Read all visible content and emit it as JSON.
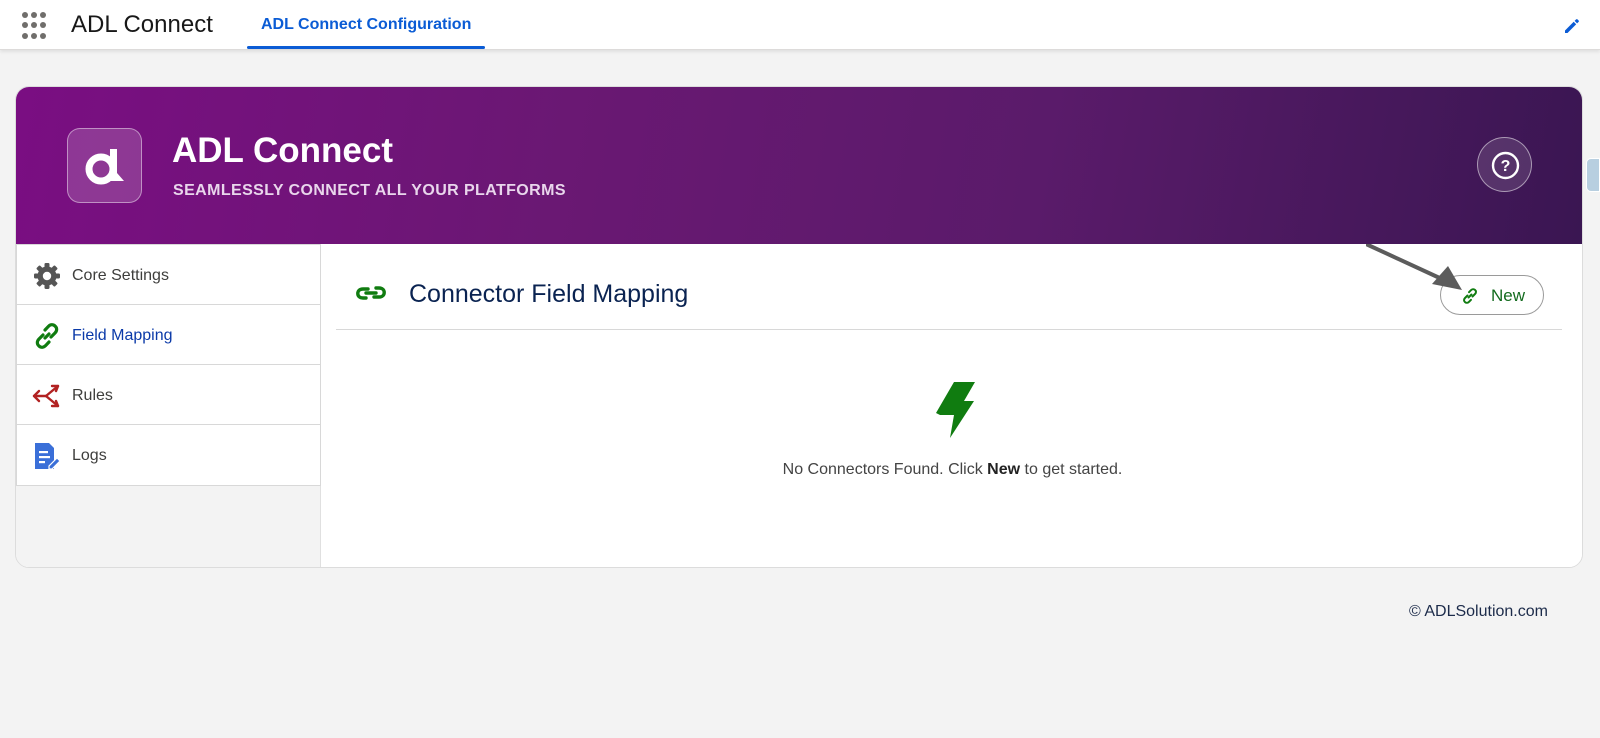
{
  "topnav": {
    "app_name": "ADL Connect",
    "tab_label": "ADL Connect Configuration"
  },
  "banner": {
    "title": "ADL Connect",
    "subtitle": "SEAMLESSLY CONNECT ALL YOUR PLATFORMS",
    "help_symbol": "?",
    "gradient_start": "#7a0e82",
    "gradient_end": "#3a1652"
  },
  "sidebar": {
    "items": [
      {
        "label": "Core Settings",
        "icon": "gear-icon",
        "active": false
      },
      {
        "label": "Field Mapping",
        "icon": "link-icon",
        "active": true
      },
      {
        "label": "Rules",
        "icon": "branch-arrows-icon",
        "active": false
      },
      {
        "label": "Logs",
        "icon": "document-edit-icon",
        "active": false
      }
    ]
  },
  "main": {
    "section_title": "Connector Field Mapping",
    "new_button_label": "New",
    "empty_prefix": "No Connectors Found. Click ",
    "empty_bold": "New",
    "empty_suffix": " to get started."
  },
  "footer": {
    "copyright": "© ADLSolution.com"
  },
  "colors": {
    "accent_blue": "#0b5cd5",
    "green": "#107c10",
    "red": "#b22222",
    "doc_blue": "#3a6fd8"
  }
}
